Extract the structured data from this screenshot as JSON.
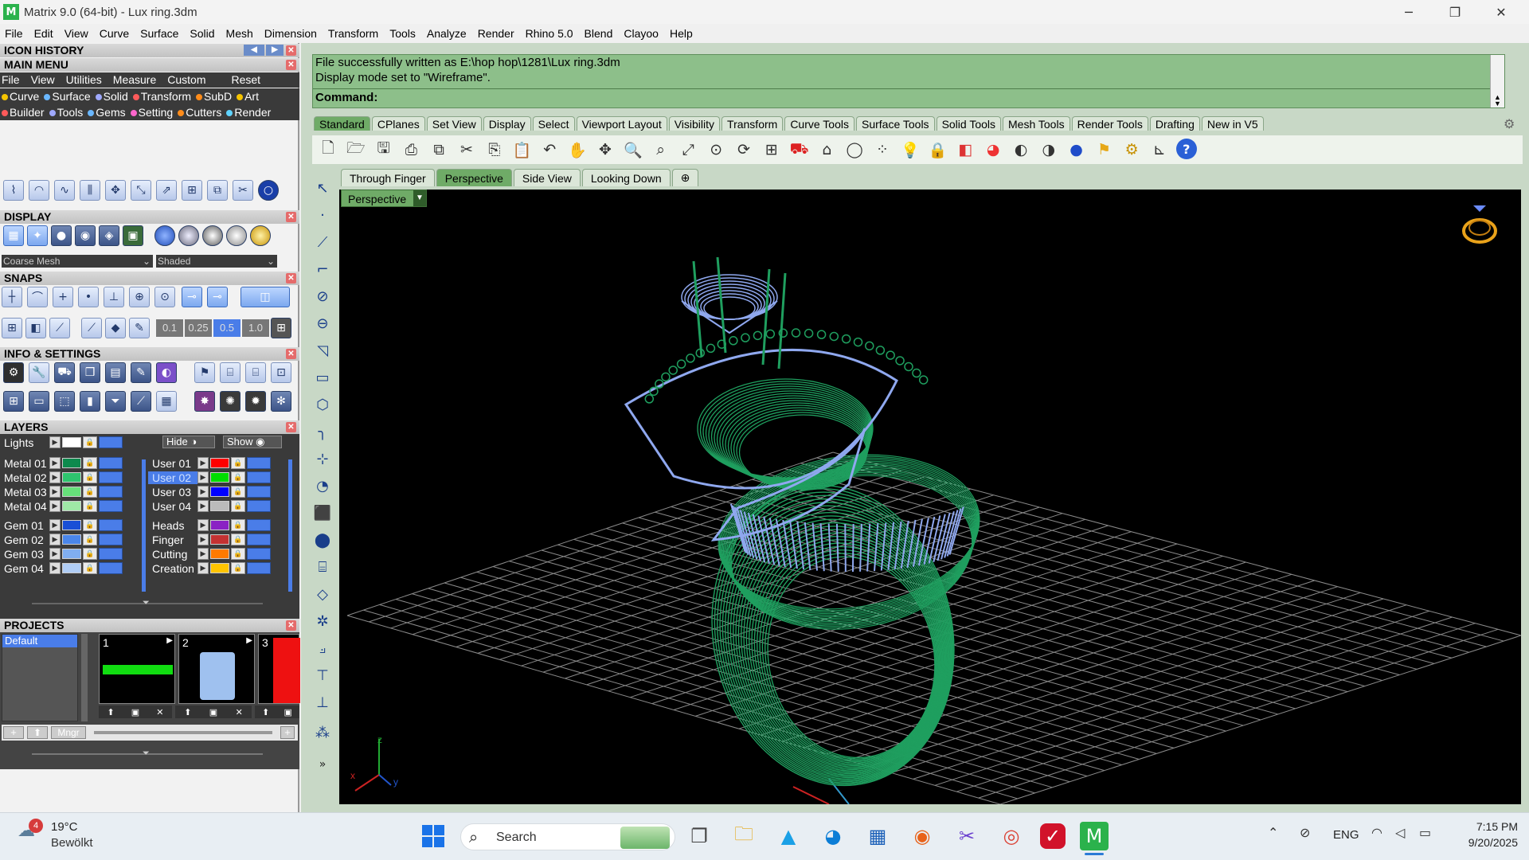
{
  "window": {
    "title": "Matrix 9.0 (64-bit) - Lux ring.3dm",
    "app_icon": "matrix-logo"
  },
  "menubar": [
    "File",
    "Edit",
    "View",
    "Curve",
    "Surface",
    "Solid",
    "Mesh",
    "Dimension",
    "Transform",
    "Tools",
    "Analyze",
    "Render",
    "Rhino 5.0",
    "Blend",
    "Clayoo",
    "Help"
  ],
  "left_panel": {
    "icon_history": "ICON HISTORY",
    "main_menu": "MAIN MENU",
    "main_menu_items": [
      "File",
      "View",
      "Utilities",
      "Measure",
      "Custom",
      "Reset"
    ],
    "categories_row1": [
      "Curve",
      "Surface",
      "Solid",
      "Transform",
      "SubD",
      "Art"
    ],
    "categories_row2": [
      "Builder",
      "Tools",
      "Gems",
      "Setting",
      "Cutters",
      "Render"
    ],
    "category_dot_colors": [
      "#f5c400",
      "#6ab7ff",
      "#9fa9ff",
      "#ff5a5a",
      "#ff8c1a",
      "#f5c400",
      "#ff5a5a",
      "#9fa9ff",
      "#6ab7ff",
      "#ff66cc",
      "#ff8c1a",
      "#5fd3ff"
    ],
    "display": "DISPLAY",
    "display_mesh": "Coarse Mesh",
    "display_mode": "Shaded",
    "snaps": "SNAPS",
    "snap_values": [
      "0.1",
      "0.25",
      "0.5",
      "1.0"
    ],
    "info_settings": "INFO & SETTINGS",
    "layers": "LAYERS",
    "lights_label": "Lights",
    "hide_label": "Hide",
    "show_label": "Show",
    "layers_left": [
      {
        "name": "Metal 01",
        "color": "#0d8a4d"
      },
      {
        "name": "Metal 02",
        "color": "#2ec46e"
      },
      {
        "name": "Metal 03",
        "color": "#66e07a"
      },
      {
        "name": "Metal 04",
        "color": "#9fe8a6"
      },
      {
        "name": "Gem 01",
        "color": "#1a4fd6"
      },
      {
        "name": "Gem 02",
        "color": "#4a86ea"
      },
      {
        "name": "Gem 03",
        "color": "#80aef0"
      },
      {
        "name": "Gem 04",
        "color": "#b0cdf5"
      }
    ],
    "layers_right": [
      {
        "name": "User 01",
        "color": "#ff0000"
      },
      {
        "name": "User 02",
        "color": "#00dd00"
      },
      {
        "name": "User 03",
        "color": "#0000ff"
      },
      {
        "name": "User 04",
        "color": "#bbbbbb"
      },
      {
        "name": "Heads",
        "color": "#8a22c4"
      },
      {
        "name": "Finger",
        "color": "#c43232"
      },
      {
        "name": "Cutting",
        "color": "#ff7a00"
      },
      {
        "name": "Creation",
        "color": "#ffc400"
      }
    ],
    "projects": "PROJECTS",
    "projects_list": [
      "Default"
    ],
    "project_numbers": [
      "1",
      "2",
      "3"
    ],
    "mngr_label": "Mngr"
  },
  "command": {
    "line1": "File successfully written as E:\\hop hop\\1281\\Lux ring.3dm",
    "line2": "Display mode set to \"Wireframe\".",
    "prompt": "Command:"
  },
  "toolbar_tabs": [
    "Standard",
    "CPlanes",
    "Set View",
    "Display",
    "Select",
    "Viewport Layout",
    "Visibility",
    "Transform",
    "Curve Tools",
    "Surface Tools",
    "Solid Tools",
    "Mesh Tools",
    "Render Tools",
    "Drafting",
    "New in V5"
  ],
  "toolbar_icons": [
    "new-file-icon",
    "open-file-icon",
    "save-icon",
    "print-icon",
    "export-icon",
    "cut-icon",
    "copy-icon",
    "paste-icon",
    "undo-icon",
    "pan-hand-icon",
    "move-view-icon",
    "zoom-icon",
    "zoom-window-icon",
    "zoom-extents-icon",
    "zoom-selected-icon",
    "rotate-view-icon",
    "four-viewports-icon",
    "car-icon",
    "grid-hat-icon",
    "circle-icon",
    "snap-point-icon",
    "light-bulb-icon",
    "lock-icon",
    "layer-icon",
    "color-wheel-icon",
    "render-sphere-icon",
    "shaded-sphere-icon",
    "blue-sphere-icon",
    "tools-icon",
    "settings-icon",
    "dimension-icon",
    "help-icon"
  ],
  "viewport_tabs": [
    "Through Finger",
    "Perspective",
    "Side View",
    "Looking Down"
  ],
  "viewport_label": "Perspective",
  "axis_labels": {
    "x": "x",
    "y": "y",
    "z": "z"
  },
  "colors": {
    "wire_green": "#1f9f5f",
    "gem_blue": "#8fa8ef",
    "grid": "#8a8a8a",
    "cmd_bg": "#8dbf8a",
    "accent": "#6fab67"
  },
  "taskbar": {
    "weather_temp": "19°C",
    "weather_desc": "Bewölkt",
    "weather_badge": "4",
    "search": "Search",
    "lang": "ENG",
    "time": "7:15 PM",
    "date": "9/20/2025"
  }
}
